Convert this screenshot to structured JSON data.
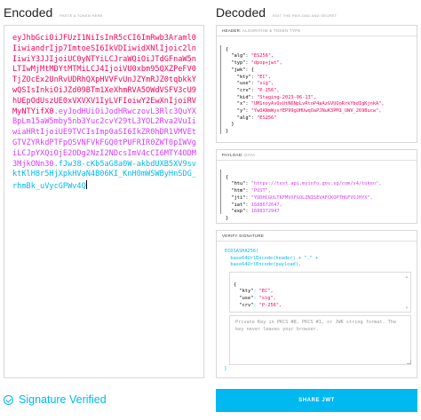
{
  "encoded": {
    "title": "Encoded",
    "subtitle": "PASTE A TOKEN HERE",
    "token_header": "eyJhbGciOiJFUzI1NiIsInR5cCI6ImRwb3Araml0IiwiandrIjp7ImtoeSI6IkVDIiwidXNlIjoic2lnIiwiY3JJIjoiUC0yNTYiLCJraWQiOiJTdGFnaW5nLTIwMjMtMDYtMTMiLCJ4IjoiVU0xbm95QXZPeFV0TjZOcEx2UnRvUDRhQXpHVVFvUnJZYmRJZ0tqbkkYwQSIsInkiOiJZd09BTm1XeXhmRVA5OWdVSFV3cU9hUEpOdUszUE0xVXVXV1IyLVFIoiwY2EwXnIjoiRVMyNTYifX0",
    "token_payload": ".eyJodHUiOiJodHRwczovL3Rlc3QuYXBpLm15aW5mby5nb3Yuc2cvY29tL3YOL2Rva2VuIiwiaHRtIjoiUE9TVCIsImp0aSI6IkZR0hDR1VMVEtGTVZYRkdPTFpOSVNFVkFGQ0tPUFRIR0ZWT0pIWVgiLCJpYXQiOjE2ODg2NzI2NDcsImV4cCI6MTY4ODM3MjkONn30",
    "token_sig": ".fJw38-cKb5aG8a0W-akbdUXB5XV9svktKlH8r5HjXpkHVaN4B06KI_KnH0mWSWByHnSDG_rhmBk_uVycGPWv4Q"
  },
  "decoded": {
    "title": "Decoded",
    "subtitle": "EDIT THE PAYLOAD AND SECRET",
    "header": {
      "label": "HEADER:",
      "sublabel": "ALGORITHM & TOKEN TYPE",
      "lines": [
        {
          "k": "\"alg\"",
          "v": "\"ES256\","
        },
        {
          "k": "\"typ\"",
          "v": "\"dpop+jwt\","
        },
        {
          "k": "\"jwk\"",
          "v": "{"
        },
        {
          "k": "\"kty\"",
          "v": "\"EC\","
        },
        {
          "k": "\"use\"",
          "v": "\"sig\","
        },
        {
          "k": "\"crv\"",
          "v": "\"P-256\","
        },
        {
          "k": "\"kid\"",
          "v": "\"Staging-2023-06-13\","
        },
        {
          "k": "\"x\"",
          "v": "\"UM1noyAvOxUtN6NpLvRtoP4aAzGVUQoRrkYbdIgKjnkA\","
        },
        {
          "k": "\"y\"",
          "v": "\"YwOANmWyxfEP99gUHUwqOaPJNuK3PM1_UWV_269Bucw\","
        },
        {
          "k": "\"alg\"",
          "v": "\"ES256\""
        }
      ]
    },
    "payload": {
      "label": "PAYLOAD:",
      "sublabel": "DATA",
      "lines": [
        {
          "k": "\"htu\"",
          "v": "\"https://test.api.myinfo.gov.sg/com/v4/token\","
        },
        {
          "k": "\"htm\"",
          "v": "\"POST\","
        },
        {
          "k": "\"jti\"",
          "v": "\"YUDHCGULTKFMVXFGOLZNISEVAFCKOPTHGFVOJHYX\","
        },
        {
          "k": "\"iat\"",
          "v": "1688672647,"
        },
        {
          "k": "\"exp\"",
          "v": "1688372947"
        }
      ]
    },
    "verify": {
      "label": "VERIFY SIGNATURE",
      "algo_line": "ECDSASHA256(",
      "line2": "base64UrlEncode(header) + \".\" +",
      "line3": "base64UrlEncode(payload),",
      "key_lines": [
        {
          "k": "\"kty\"",
          "v": "\"EC\","
        },
        {
          "k": "\"use\"",
          "v": "\"sig\","
        },
        {
          "k": "\"crv\"",
          "v": "\"P-256\","
        }
      ],
      "private_placeholder": "Private Key in PKCS #8, PKCS #1, or JWK string format. The key never leaves your browser."
    }
  },
  "status": {
    "verified": "Signature Verified"
  },
  "share_button": "SHARE JWT"
}
